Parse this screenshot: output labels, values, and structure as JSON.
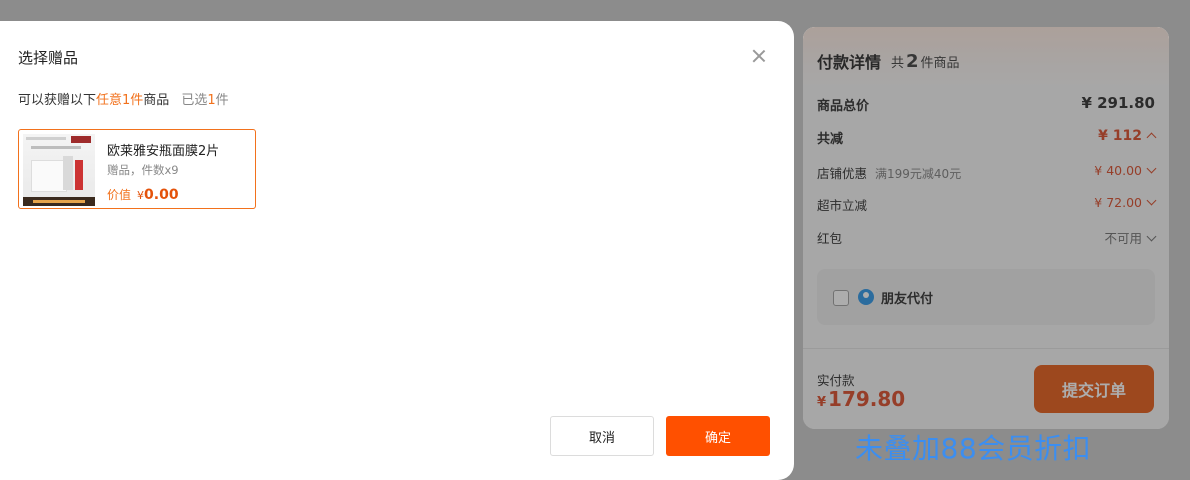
{
  "modal": {
    "title": "选择赠品",
    "rule_prefix": "可以获赠以下",
    "rule_highlight": "任意1件",
    "rule_suffix": "商品",
    "selected_prefix": "已选",
    "selected_count": "1",
    "selected_suffix": "件",
    "gift": {
      "name": "欧莱雅安瓶面膜2片",
      "meta": "赠品，件数x9",
      "price_label": "价值",
      "currency": "¥",
      "price": "0.00"
    },
    "cancel_label": "取消",
    "confirm_label": "确定"
  },
  "payment": {
    "title": "付款详情",
    "count_prefix": "共",
    "count": "2",
    "count_suffix": "件商品",
    "total_label": "商品总价",
    "total_value": "¥ 291.80",
    "discount_label": "共减",
    "discount_value": "¥ 112",
    "store_label": "店铺优惠",
    "store_desc": "满199元减40元",
    "store_value": "¥ 40.00",
    "market_label": "超市立减",
    "market_value": "¥ 72.00",
    "redpacket_label": "红包",
    "redpacket_value": "不可用",
    "friend_pay_label": "朋友代付",
    "actual_label": "实付款",
    "actual_currency": "¥",
    "actual_value": "179.80",
    "submit_label": "提交订单"
  },
  "watermark": "未叠加88会员折扣",
  "colors": {
    "accent": "#ff5000",
    "highlight": "#f2711c",
    "discount_red": "#d8401d",
    "watermark_blue": "#3c8ef0"
  }
}
